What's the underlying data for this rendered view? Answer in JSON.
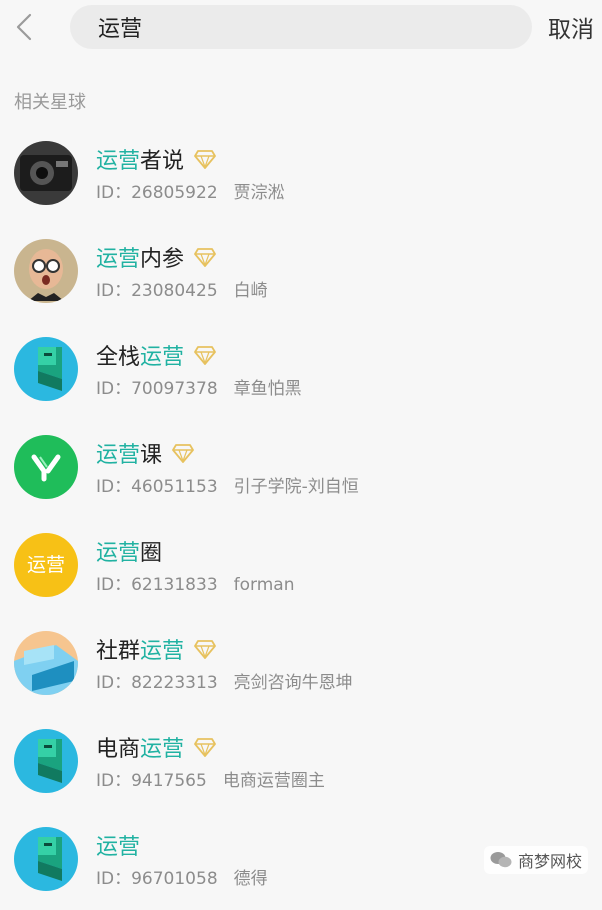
{
  "header": {
    "search_value": "运营",
    "cancel_label": "取消"
  },
  "section": {
    "title": "相关星球"
  },
  "results": [
    {
      "title_parts": [
        "运营",
        "者说"
      ],
      "highlight_first": true,
      "premium": true,
      "id_label": "ID：26805922",
      "owner": "贾淙淞",
      "avatar": "camera"
    },
    {
      "title_parts": [
        "运营",
        "内参"
      ],
      "highlight_first": true,
      "premium": true,
      "id_label": "ID：23080425",
      "owner": "白崎",
      "avatar": "person"
    },
    {
      "title_parts": [
        "全栈",
        "运营"
      ],
      "highlight_first": false,
      "premium": true,
      "id_label": "ID：70097378",
      "owner": "章鱼怕黑",
      "avatar": "planet-blue"
    },
    {
      "title_parts": [
        "运营",
        "课"
      ],
      "highlight_first": true,
      "premium": true,
      "id_label": "ID：46051153",
      "owner": "引子学院-刘自恒",
      "avatar": "green-y"
    },
    {
      "title_parts": [
        "运营",
        "圈"
      ],
      "highlight_first": true,
      "premium": false,
      "id_label": "ID：62131833",
      "owner": "forman",
      "avatar": "yellow-text"
    },
    {
      "title_parts": [
        "社群",
        "运营"
      ],
      "highlight_first": false,
      "premium": true,
      "id_label": "ID：82223313",
      "owner": "亮剑咨询牛恩坤",
      "avatar": "planet-orange"
    },
    {
      "title_parts": [
        "电商",
        "运营"
      ],
      "highlight_first": false,
      "premium": true,
      "id_label": "ID：9417565",
      "owner": "电商运营圈主",
      "avatar": "planet-blue"
    },
    {
      "title_parts": [
        "运营",
        ""
      ],
      "highlight_first": true,
      "premium": false,
      "id_label": "ID：96701058",
      "owner": "德得",
      "avatar": "planet-blue"
    }
  ],
  "avatar_texts": {
    "yellow-text": "运营"
  },
  "watermark": {
    "text": "商梦网校"
  },
  "colors": {
    "highlight": "#21b2a2",
    "diamond": "#e7c25f"
  }
}
